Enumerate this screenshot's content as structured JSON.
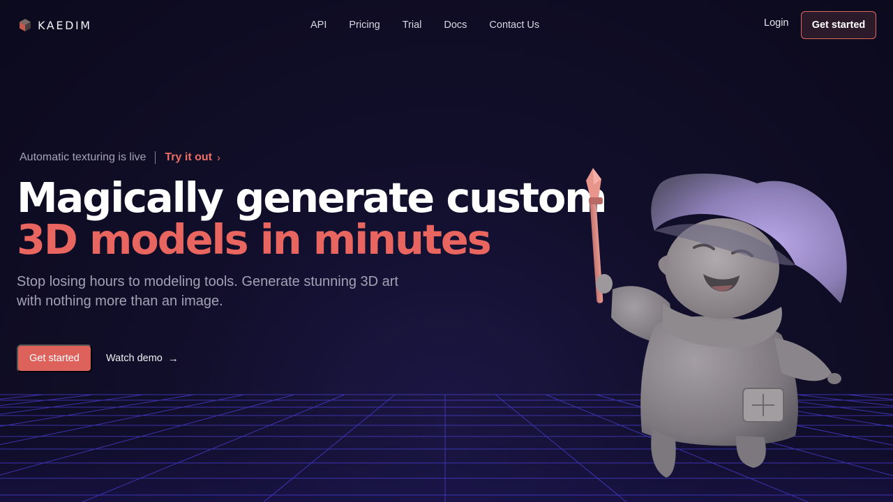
{
  "brand": {
    "name": "KAEDIM",
    "logo_icon": "cube-logo-icon"
  },
  "nav": {
    "links": [
      "API",
      "Pricing",
      "Trial",
      "Docs",
      "Contact Us"
    ],
    "login": "Login",
    "cta": "Get started"
  },
  "announcement": {
    "text": "Automatic texturing is live",
    "link": "Try it out",
    "icon": "chevron-right-icon"
  },
  "hero": {
    "title_line1": "Magically generate custom",
    "title_line2": "3D models in minutes",
    "subtitle": "Stop losing hours to modeling tools. Generate stunning 3D art with nothing more than an image.",
    "primary_cta": "Get started",
    "secondary_cta": "Watch demo",
    "secondary_icon": "arrow-right-icon",
    "illustration": "wizard-character-3d-model"
  },
  "colors": {
    "background": "#0d0b1f",
    "accent": "#e9655f",
    "grid": "#4b3fd6"
  }
}
